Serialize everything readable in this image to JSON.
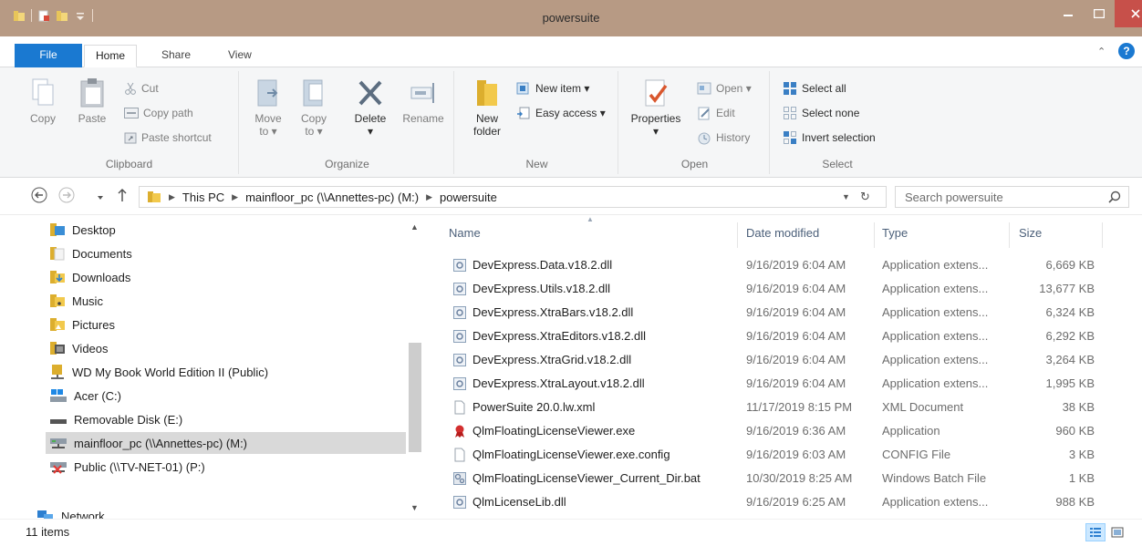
{
  "window": {
    "title": "powersuite"
  },
  "ribbon_tabs": {
    "file": "File",
    "home": "Home",
    "share": "Share",
    "view": "View"
  },
  "ribbon": {
    "clipboard": {
      "label": "Clipboard",
      "copy": "Copy",
      "paste": "Paste",
      "cut": "Cut",
      "copy_path": "Copy path",
      "paste_shortcut": "Paste shortcut"
    },
    "organize": {
      "label": "Organize",
      "move_to": "Move",
      "move_to_2": "to ▾",
      "copy_to": "Copy",
      "copy_to_2": "to ▾",
      "delete": "Delete",
      "delete_2": "▾",
      "rename": "Rename"
    },
    "new": {
      "label": "New",
      "new_folder": "New",
      "new_folder_2": "folder",
      "new_item": "New item ▾",
      "easy_access": "Easy access ▾"
    },
    "open": {
      "label": "Open",
      "properties": "Properties",
      "properties_2": "▾",
      "open": "Open ▾",
      "edit": "Edit",
      "history": "History"
    },
    "select": {
      "label": "Select",
      "select_all": "Select all",
      "select_none": "Select none",
      "invert_selection": "Invert selection"
    }
  },
  "address": {
    "crumbs": [
      "This PC",
      "mainfloor_pc (\\\\Annettes-pc) (M:)",
      "powersuite"
    ],
    "search_placeholder": "Search powersuite"
  },
  "nav_pane": {
    "items": [
      {
        "label": "Desktop",
        "icon": "desktop-folder-icon"
      },
      {
        "label": "Documents",
        "icon": "documents-folder-icon"
      },
      {
        "label": "Downloads",
        "icon": "downloads-folder-icon"
      },
      {
        "label": "Music",
        "icon": "music-folder-icon"
      },
      {
        "label": "Pictures",
        "icon": "pictures-folder-icon"
      },
      {
        "label": "Videos",
        "icon": "videos-folder-icon"
      },
      {
        "label": "WD My Book World Edition II (Public)",
        "icon": "network-share-icon"
      },
      {
        "label": "Acer (C:)",
        "icon": "os-drive-icon"
      },
      {
        "label": "Removable Disk (E:)",
        "icon": "removable-disk-icon"
      },
      {
        "label": "mainfloor_pc (\\\\Annettes-pc) (M:)",
        "icon": "network-drive-icon",
        "selected": true
      },
      {
        "label": "Public (\\\\TV-NET-01) (P:)",
        "icon": "disconnected-drive-icon"
      },
      {
        "label": "Network",
        "icon": "network-icon"
      }
    ]
  },
  "file_list": {
    "columns": {
      "name": "Name",
      "date": "Date modified",
      "type": "Type",
      "size": "Size"
    },
    "rows": [
      {
        "name": "DevExpress.Data.v18.2.dll",
        "date": "9/16/2019 6:04 AM",
        "type": "Application extens...",
        "size": "6,669 KB",
        "icon": "dll-icon"
      },
      {
        "name": "DevExpress.Utils.v18.2.dll",
        "date": "9/16/2019 6:04 AM",
        "type": "Application extens...",
        "size": "13,677 KB",
        "icon": "dll-icon"
      },
      {
        "name": "DevExpress.XtraBars.v18.2.dll",
        "date": "9/16/2019 6:04 AM",
        "type": "Application extens...",
        "size": "6,324 KB",
        "icon": "dll-icon"
      },
      {
        "name": "DevExpress.XtraEditors.v18.2.dll",
        "date": "9/16/2019 6:04 AM",
        "type": "Application extens...",
        "size": "6,292 KB",
        "icon": "dll-icon"
      },
      {
        "name": "DevExpress.XtraGrid.v18.2.dll",
        "date": "9/16/2019 6:04 AM",
        "type": "Application extens...",
        "size": "3,264 KB",
        "icon": "dll-icon"
      },
      {
        "name": "DevExpress.XtraLayout.v18.2.dll",
        "date": "9/16/2019 6:04 AM",
        "type": "Application extens...",
        "size": "1,995 KB",
        "icon": "dll-icon"
      },
      {
        "name": "PowerSuite 20.0.lw.xml",
        "date": "11/17/2019 8:15 PM",
        "type": "XML Document",
        "size": "38 KB",
        "icon": "document-icon"
      },
      {
        "name": "QlmFloatingLicenseViewer.exe",
        "date": "9/16/2019 6:36 AM",
        "type": "Application",
        "size": "960 KB",
        "icon": "ribbon-award-icon"
      },
      {
        "name": "QlmFloatingLicenseViewer.exe.config",
        "date": "9/16/2019 6:03 AM",
        "type": "CONFIG File",
        "size": "3 KB",
        "icon": "document-icon"
      },
      {
        "name": "QlmFloatingLicenseViewer_Current_Dir.bat",
        "date": "10/30/2019 8:25 AM",
        "type": "Windows Batch File",
        "size": "1 KB",
        "icon": "batch-file-icon"
      },
      {
        "name": "QlmLicenseLib.dll",
        "date": "9/16/2019 6:25 AM",
        "type": "Application extens...",
        "size": "988 KB",
        "icon": "dll-icon"
      }
    ]
  },
  "status": {
    "item_count": "11 items"
  },
  "colors": {
    "accent": "#1a79d1",
    "titlebar": "#b79a84",
    "close": "#c7504a",
    "selection": "#cce8ff"
  }
}
